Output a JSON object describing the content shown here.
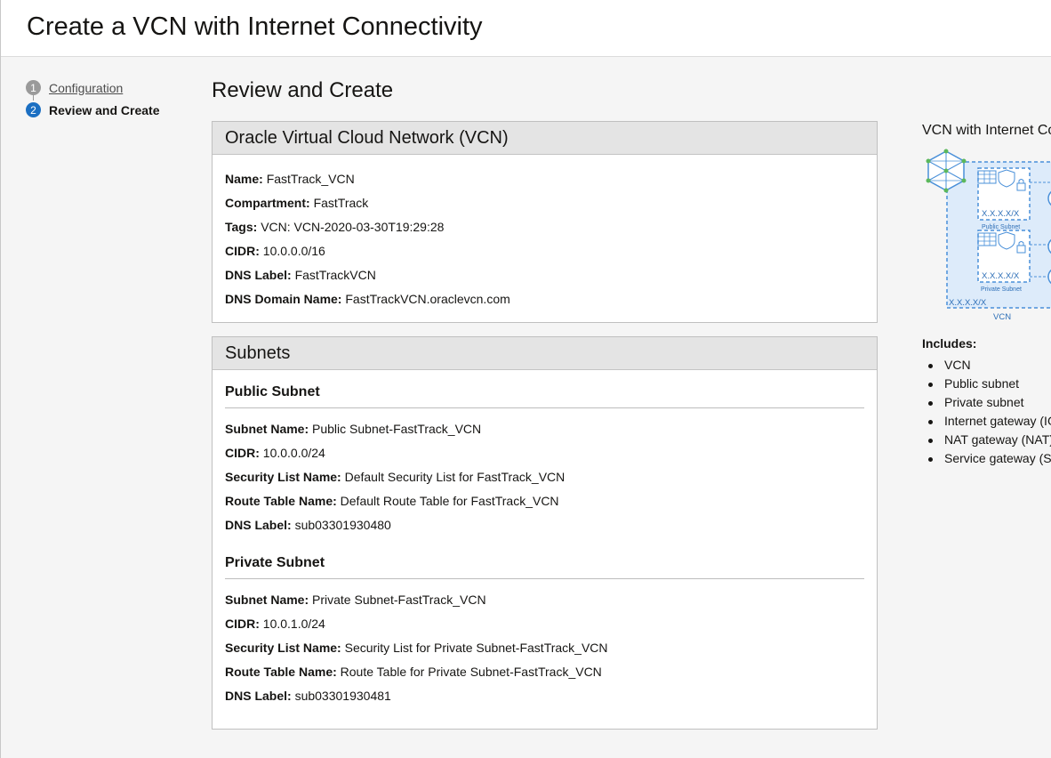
{
  "page": {
    "title": "Create a VCN with Internet Connectivity"
  },
  "steps": [
    {
      "number": "1",
      "label": "Configuration",
      "state": "done"
    },
    {
      "number": "2",
      "label": "Review and Create",
      "state": "current"
    }
  ],
  "main": {
    "title": "Review and Create"
  },
  "vcn_panel": {
    "title": "Oracle Virtual Cloud Network (VCN)",
    "fields": [
      {
        "label": "Name:",
        "value": "FastTrack_VCN"
      },
      {
        "label": "Compartment:",
        "value": "FastTrack"
      },
      {
        "label": "Tags:",
        "value": "VCN: VCN-2020-03-30T19:29:28"
      },
      {
        "label": "CIDR:",
        "value": "10.0.0.0/16"
      },
      {
        "label": "DNS Label:",
        "value": "FastTrackVCN"
      },
      {
        "label": "DNS Domain Name:",
        "value": "FastTrackVCN.oraclevcn.com"
      }
    ]
  },
  "subnets_panel": {
    "title": "Subnets",
    "public": {
      "heading": "Public Subnet",
      "fields": [
        {
          "label": "Subnet Name:",
          "value": "Public Subnet-FastTrack_VCN"
        },
        {
          "label": "CIDR:",
          "value": "10.0.0.0/24"
        },
        {
          "label": "Security List Name:",
          "value": "Default Security List for FastTrack_VCN"
        },
        {
          "label": "Route Table Name:",
          "value": "Default Route Table for FastTrack_VCN"
        },
        {
          "label": "DNS Label:",
          "value": "sub03301930480"
        }
      ]
    },
    "private": {
      "heading": "Private Subnet",
      "fields": [
        {
          "label": "Subnet Name:",
          "value": "Private Subnet-FastTrack_VCN"
        },
        {
          "label": "CIDR:",
          "value": "10.0.1.0/24"
        },
        {
          "label": "Security List Name:",
          "value": "Security List for Private Subnet-FastTrack_VCN"
        },
        {
          "label": "Route Table Name:",
          "value": "Route Table for Private Subnet-FastTrack_VCN"
        },
        {
          "label": "DNS Label:",
          "value": "sub03301930481"
        }
      ]
    }
  },
  "sidebar": {
    "title": "VCN with Internet Co",
    "diagram": {
      "public_cidr": "X.X.X.X/X",
      "public_label": "Public Subnet",
      "private_cidr": "X.X.X.X/X",
      "private_label": "Private Subnet",
      "vcn_cidr": "X.X.X.X/X",
      "vcn_label": "VCN"
    },
    "includes_label": "Includes:",
    "includes": [
      "VCN",
      "Public subnet",
      "Private subnet",
      "Internet gateway (IG",
      "NAT gateway (NAT)",
      "Service gateway (S"
    ]
  },
  "colors": {
    "accent": "#1b6fc2",
    "diagram_blue": "#4a90d9"
  }
}
